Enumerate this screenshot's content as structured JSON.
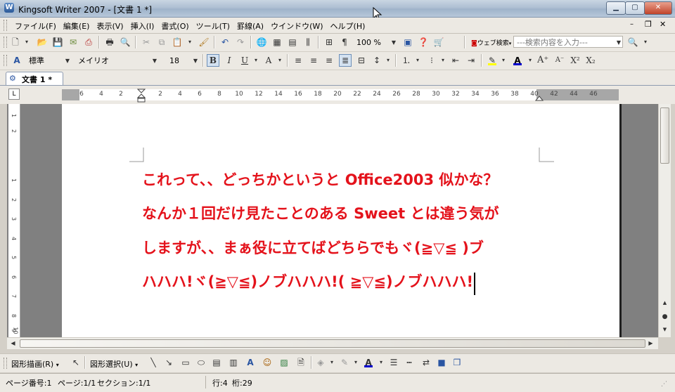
{
  "window": {
    "title": "Kingsoft Writer 2007 - [文書 1 *]"
  },
  "menu": [
    "ファイル(F)",
    "編集(E)",
    "表示(V)",
    "挿入(I)",
    "書式(O)",
    "ツール(T)",
    "罫線(A)",
    "ウインドウ(W)",
    "ヘルプ(H)"
  ],
  "toolbar": {
    "zoom": "100 %",
    "web_search_label": "ウェブ検索",
    "search_placeholder": "---検索内容を入力---"
  },
  "format": {
    "style": "標準",
    "font": "メイリオ",
    "size": "18",
    "bold": "B",
    "italic": "I",
    "underline": "U",
    "font_color": "#0000cc",
    "highlight_color": "#ffff00"
  },
  "tab": {
    "label": "文書 1 *"
  },
  "ruler": {
    "left_numbers": [
      "6",
      "4",
      "2"
    ],
    "right_numbers": [
      "2",
      "4",
      "6",
      "8",
      "10",
      "12",
      "14",
      "16",
      "18",
      "20",
      "22",
      "24",
      "26",
      "28",
      "30",
      "32",
      "34",
      "36",
      "38",
      "40",
      "42",
      "44",
      "46"
    ],
    "vertical_numbers": [
      "1",
      "2",
      "1",
      "2",
      "3",
      "4",
      "5",
      "6",
      "7",
      "8",
      "9",
      "10"
    ]
  },
  "document": {
    "text_color": "#e4121b",
    "lines": [
      "これって、、どっちかというと Office2003 似かな？",
      "なんか１回だけ見たことのある Sweet とは違う気が",
      "しますが、、まぁ役に立てばどちらでもヾ(≧▽≦ )ブ",
      "ハハハ!ヾ(≧▽≦)ノブハハハ!( ≧▽≦)ノブハハハ!"
    ]
  },
  "drawbar": {
    "draw_label": "図形描画(R)",
    "select_label": "図形選択(U)"
  },
  "status": {
    "page_no": "ページ番号:1",
    "page": "ページ:1/1",
    "section": "セクション:1/1",
    "row": "行:4",
    "col": "桁:29"
  }
}
